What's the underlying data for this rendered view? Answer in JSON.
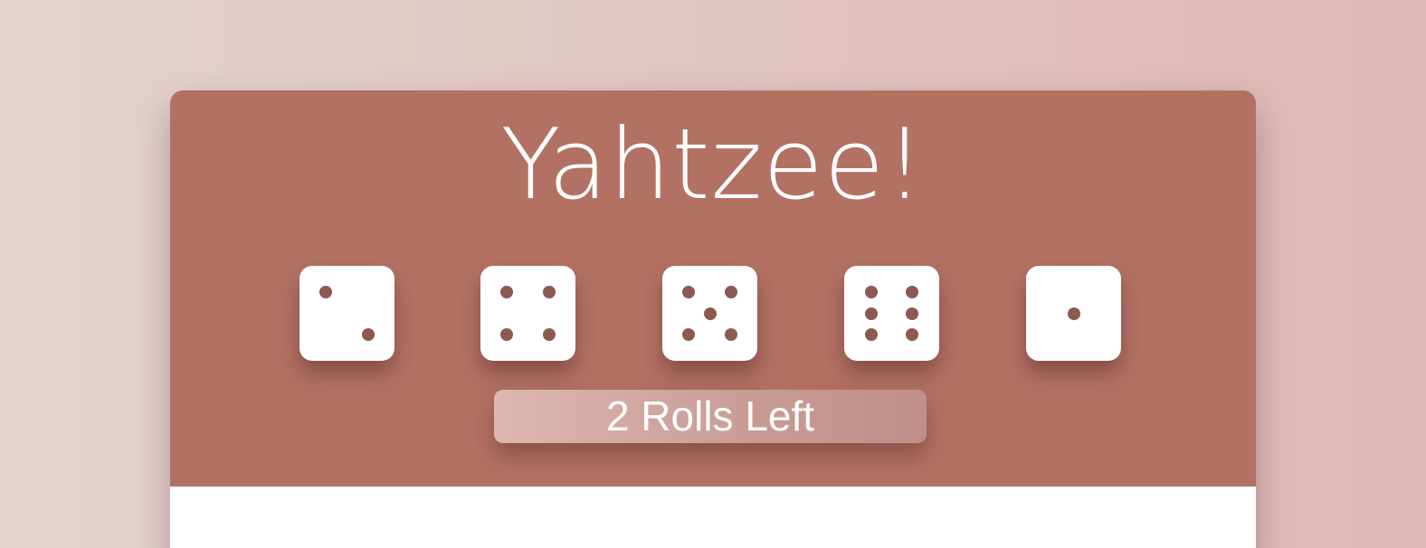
{
  "header": {
    "title": "Yahtzee!"
  },
  "dice": [
    {
      "value": 2
    },
    {
      "value": 4
    },
    {
      "value": 5
    },
    {
      "value": 6
    },
    {
      "value": 1
    }
  ],
  "roll_button": {
    "label": "2 Rolls Left"
  },
  "colors": {
    "header_bg": "#b37164",
    "pip": "#8c5a50",
    "die_face": "#ffffff"
  }
}
